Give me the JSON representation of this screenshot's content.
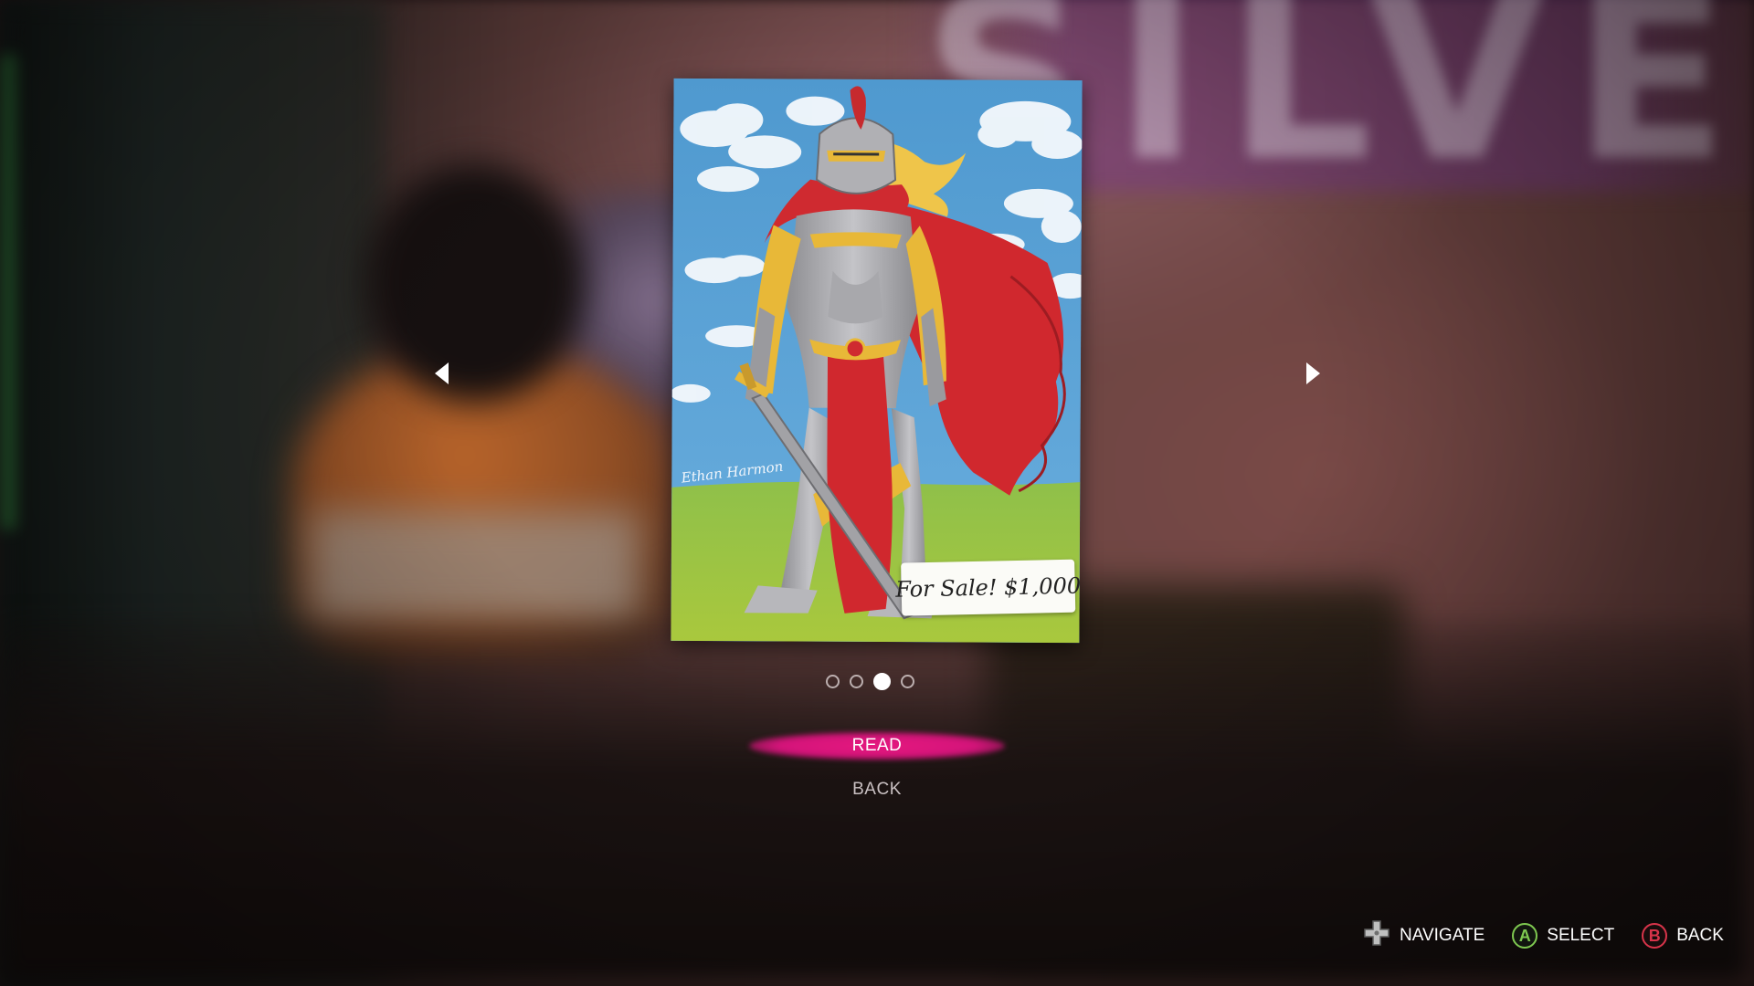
{
  "poster": {
    "signature": "Ethan Harmon",
    "sale_note": "For Sale! $1,000"
  },
  "pagination": {
    "total": 4,
    "current": 3
  },
  "menu": {
    "read_label": "READ",
    "back_label": "BACK",
    "selected": "read"
  },
  "hints": {
    "navigate_label": "NAVIGATE",
    "select_label": "SELECT",
    "back_label": "BACK",
    "navigate_icon": "dpad-icon",
    "select_icon": "a-button-icon",
    "back_icon": "b-button-icon",
    "select_button_text": "A",
    "back_button_text": "B"
  },
  "colors": {
    "accent": "#e6187f",
    "a_button": "#7ec850",
    "b_button": "#d8344a"
  }
}
